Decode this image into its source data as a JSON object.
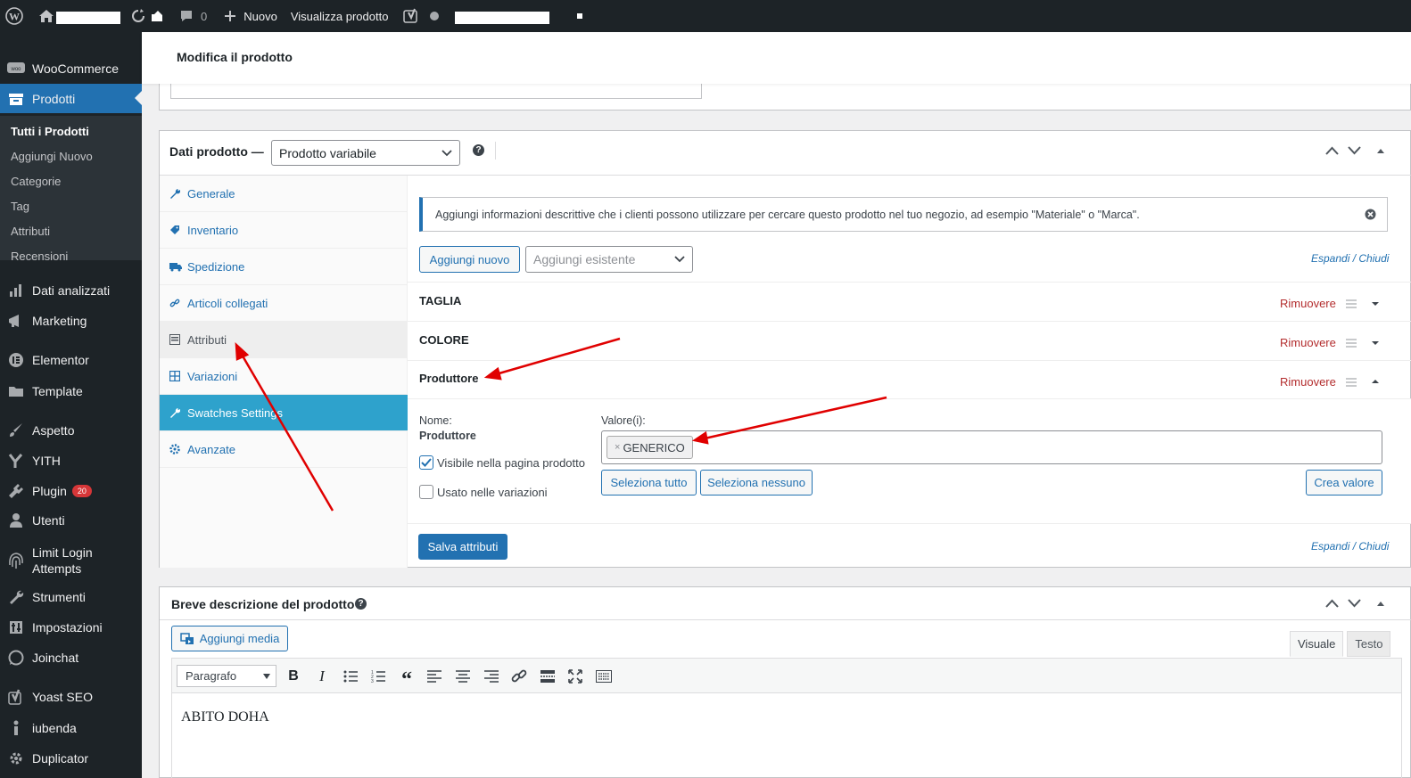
{
  "adminbar": {
    "new_label": "Nuovo",
    "view_product": "Visualizza prodotto",
    "comments_count": "0"
  },
  "sidebar": {
    "items": [
      {
        "label": "WooCommerce",
        "icon": "woocommerce-icon"
      },
      {
        "label": "Prodotti",
        "icon": "products-icon"
      },
      {
        "label": "Dati analizzati",
        "icon": "analytics-icon"
      },
      {
        "label": "Marketing",
        "icon": "marketing-icon"
      },
      {
        "label": "Elementor",
        "icon": "elementor-icon"
      },
      {
        "label": "Template",
        "icon": "folder-icon"
      },
      {
        "label": "Aspetto",
        "icon": "brush-icon"
      },
      {
        "label": "YITH",
        "icon": "yith-icon"
      },
      {
        "label": "Plugin",
        "icon": "plugin-icon",
        "badge": "20"
      },
      {
        "label": "Utenti",
        "icon": "user-icon"
      },
      {
        "label": "Limit Login Attempts",
        "icon": "fingerprint-icon"
      },
      {
        "label": "Strumenti",
        "icon": "wrench-icon"
      },
      {
        "label": "Impostazioni",
        "icon": "settings-icon"
      },
      {
        "label": "Joinchat",
        "icon": "whatsapp-icon"
      },
      {
        "label": "Yoast SEO",
        "icon": "yoast-icon"
      },
      {
        "label": "iubenda",
        "icon": "iubenda-icon"
      },
      {
        "label": "Duplicator",
        "icon": "duplicator-icon"
      }
    ],
    "submenu": [
      "Tutti i Prodotti",
      "Aggiungi Nuovo",
      "Categorie",
      "Tag",
      "Attributi",
      "Recensioni"
    ]
  },
  "header": {
    "title": "Modifica il prodotto"
  },
  "product_data": {
    "label": "Dati prodotto —",
    "type_select": "Prodotto variabile",
    "tabs": [
      "Generale",
      "Inventario",
      "Spedizione",
      "Articoli collegati",
      "Attributi",
      "Variazioni",
      "Swatches Settings",
      "Avanzate"
    ],
    "notice": "Aggiungi informazioni descrittive che i clienti possono utilizzare per cercare questo prodotto nel tuo negozio, ad esempio \"Materiale\" o \"Marca\".",
    "add_new": "Aggiungi nuovo",
    "add_existing_placeholder": "Aggiungi esistente",
    "expand": "Espandi",
    "collapse": "Chiudi",
    "attributes": [
      {
        "name": "TAGLIA",
        "remove": "Rimuovere"
      },
      {
        "name": "COLORE",
        "remove": "Rimuovere"
      },
      {
        "name": "Produttore",
        "remove": "Rimuovere"
      }
    ],
    "detail": {
      "name_label": "Nome:",
      "name_value": "Produttore",
      "values_label": "Valore(i):",
      "token": "GENERICO",
      "visible_label": "Visibile nella pagina prodotto",
      "visible_checked": true,
      "variations_label": "Usato nelle variazioni",
      "variations_checked": false,
      "select_all": "Seleziona tutto",
      "select_none": "Seleziona nessuno",
      "create_value": "Crea valore"
    },
    "save_button": "Salva attributi"
  },
  "short_description": {
    "title": "Breve descrizione del prodotto",
    "add_media": "Aggiungi media",
    "tab_visual": "Visuale",
    "tab_text": "Testo",
    "format_select": "Paragrafo",
    "content": "ABITO DOHA"
  },
  "colors": {
    "admin_dark": "#1d2327",
    "primary": "#2271b1",
    "swatch_tab": "#2ea2cc",
    "remove": "#b32d2e",
    "annotation_arrow": "#e00000"
  }
}
